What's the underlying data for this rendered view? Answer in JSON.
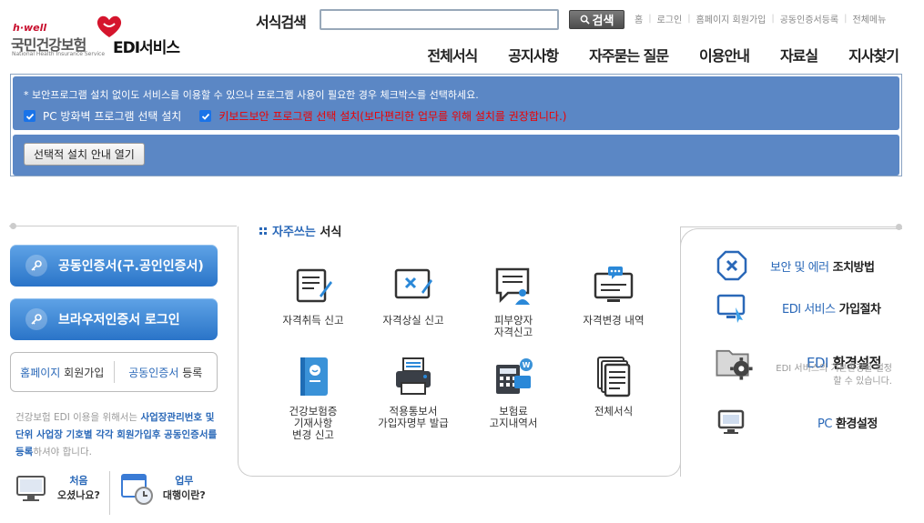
{
  "header": {
    "logo": {
      "brand": "h·well",
      "org_name": "국민건강보험",
      "org_name_en": "National Health Insurance Service",
      "service": "EDI서비스"
    },
    "search": {
      "label": "서식검색",
      "value": "",
      "placeholder": "",
      "button": "검색"
    },
    "util_links": [
      "홈",
      "로그인",
      "홈페이지 회원가입",
      "공동인증서등록",
      "전체메뉴"
    ],
    "gnb": [
      "전체서식",
      "공지사항",
      "자주묻는 질문",
      "이용안내",
      "자료실",
      "지사찾기"
    ]
  },
  "notice": {
    "message": "* 보안프로그램 설치 없이도 서비스를 이용할 수 있으나 프로그램 사용이 필요한 경우 체크박스를 선택하세요.",
    "checkbox1": "PC 방화벽 프로그램 선택 설치",
    "checkbox2": "키보드보안 프로그램 선택 설치(보다편리한 업무를 위해 설치를 권장합니다.)",
    "guide_button": "선택적 설치 안내 열기"
  },
  "left": {
    "cert_login": "공동인증서(구.공인인증서)",
    "browser_login": "브라우저인증서 로그인",
    "signup_blue": "홈페이지",
    "signup_rest": " 회원가입",
    "register_blue": "공동인증서",
    "register_rest": " 등록",
    "note_pre": "건강보험 EDI 이용을 위해서는 ",
    "note_bold1": "사업장관리번호 및 단위 사업장 기호별 각각 회원가입후 공동인증서를 등록",
    "note_post": "하셔야 합니다.",
    "first_blue": "처음",
    "first_rest": "오셨나요?",
    "agent_blue": "업무",
    "agent_rest": "대행이란?"
  },
  "center": {
    "title_blue": "자주쓰는",
    "title_rest": " 서식",
    "items": [
      {
        "label": "자격취득 신고",
        "icon": "acquire-form-icon"
      },
      {
        "label": "자격상실 신고",
        "icon": "loss-form-icon"
      },
      {
        "label": "피부양자\n자격신고",
        "icon": "dependent-icon"
      },
      {
        "label": "자격변경 내역",
        "icon": "monitor-chat-icon"
      },
      {
        "label": "건강보험증\n기재사항\n변경 신고",
        "icon": "insurance-card-icon"
      },
      {
        "label": "적용통보서\n가입자명부 발급",
        "icon": "printer-icon"
      },
      {
        "label": "보험료\n고지내역서",
        "icon": "calculator-icon"
      },
      {
        "label": "전체서식",
        "icon": "documents-icon"
      }
    ]
  },
  "right": {
    "security_blue": "보안 및 에러",
    "security_rest": " 조치방법",
    "edi_join_blue": "EDI 서비스",
    "edi_join_rest": " 가입절차",
    "edi_env_blue": "EDI",
    "edi_env_rest": " 환경설정",
    "edi_env_desc": "EDI 서비스의 기본환경을 설정 할 수 있습니다.",
    "pc_env_blue": "PC",
    "pc_env_rest": " 환경설정"
  },
  "colors": {
    "accent": "#2a68b8",
    "panel": "#5b87c5",
    "cert_button": "#3a86d8",
    "warning": "#e00000"
  }
}
